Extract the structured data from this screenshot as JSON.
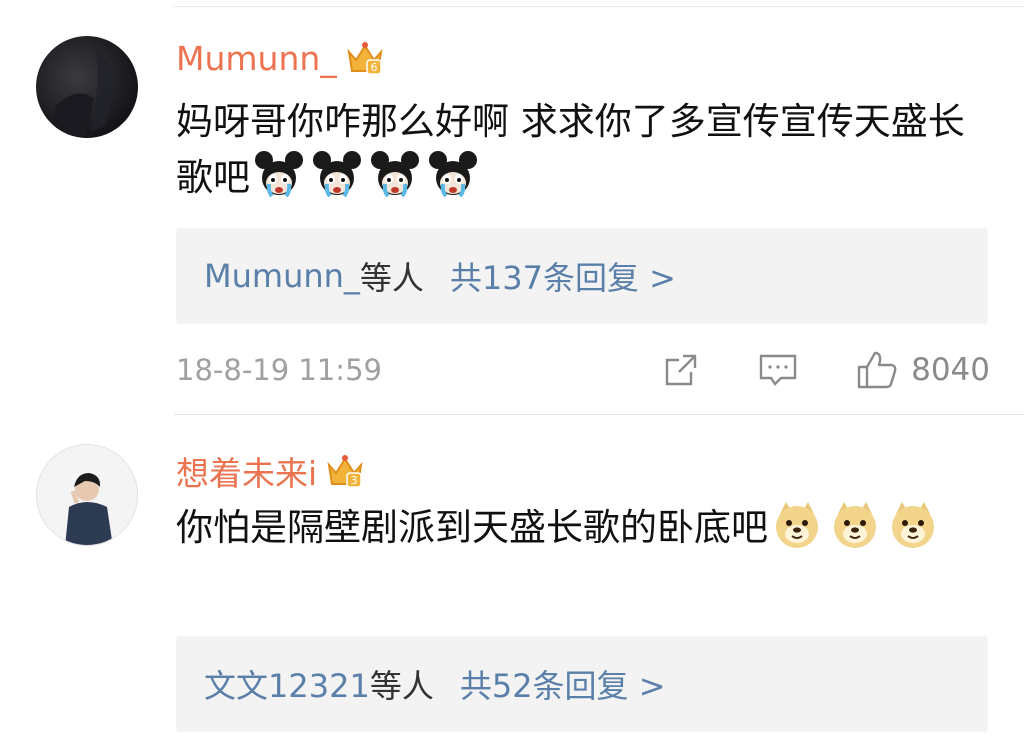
{
  "comments": [
    {
      "username": "Mumunn_",
      "badge_level": "6",
      "text": "妈呀哥你咋那么好啊 求求你了多宣传宣传天盛长歌吧",
      "emojis": [
        "mickey-crying-icon",
        "mickey-crying-icon",
        "mickey-crying-icon",
        "mickey-crying-icon"
      ],
      "replies": {
        "who": "Mumunn_",
        "suffix": "等人",
        "count_label": "共137条回复 >"
      },
      "timestamp": "18-8-19 11:59",
      "likes": "8040"
    },
    {
      "username": "想着未来i",
      "badge_level": "3",
      "text": "你怕是隔壁剧派到天盛长歌的卧底吧",
      "emojis": [
        "doge-icon",
        "doge-icon",
        "doge-icon"
      ],
      "replies": {
        "who": "文文12321",
        "suffix": "等人",
        "count_label": "共52条回复 >"
      }
    }
  ],
  "colors": {
    "username": "#eb7350",
    "link": "#5a7fa8",
    "meta": "#a0a0a0",
    "reply_bg": "#f3f3f3"
  }
}
